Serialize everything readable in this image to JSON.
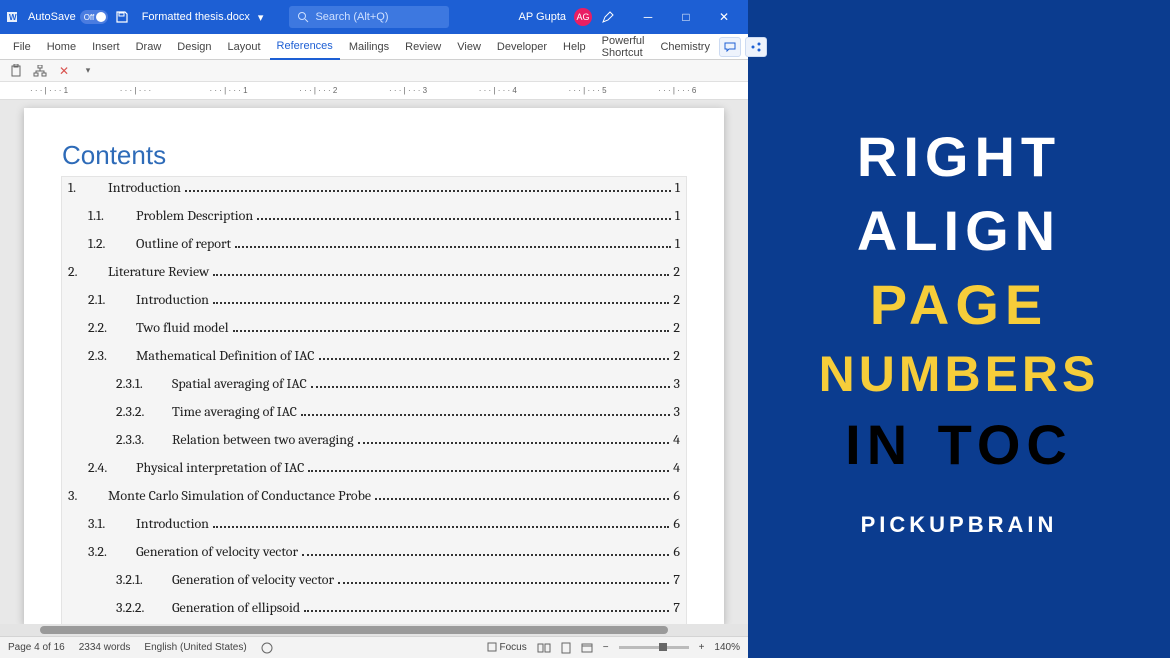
{
  "titlebar": {
    "autosave_label": "AutoSave",
    "toggle_text": "Off",
    "doc_name": "Formatted thesis.docx",
    "search_placeholder": "Search (Alt+Q)",
    "user_name": "AP Gupta",
    "user_initials": "AG"
  },
  "ribbon_tabs": [
    "File",
    "Home",
    "Insert",
    "Draw",
    "Design",
    "Layout",
    "References",
    "Mailings",
    "Review",
    "View",
    "Developer",
    "Help",
    "Powerful Shortcut",
    "Chemistry"
  ],
  "active_tab": "References",
  "ruler_marks": [
    "1",
    "",
    "1",
    "2",
    "3",
    "4",
    "5",
    "6"
  ],
  "toc": {
    "title": "Contents",
    "entries": [
      {
        "level": 1,
        "num": "1.",
        "text": "Introduction",
        "page": "1"
      },
      {
        "level": 2,
        "num": "1.1.",
        "text": "Problem Description",
        "page": "1"
      },
      {
        "level": 2,
        "num": "1.2.",
        "text": "Outline of report",
        "page": "1"
      },
      {
        "level": 1,
        "num": "2.",
        "text": "Literature Review",
        "page": "2"
      },
      {
        "level": 2,
        "num": "2.1.",
        "text": "Introduction",
        "page": "2"
      },
      {
        "level": 2,
        "num": "2.2.",
        "text": "Two fluid model",
        "page": "2"
      },
      {
        "level": 2,
        "num": "2.3.",
        "text": "Mathematical Definition of IAC",
        "page": "2"
      },
      {
        "level": 3,
        "num": "2.3.1.",
        "text": "Spatial averaging of IAC",
        "page": "3"
      },
      {
        "level": 3,
        "num": "2.3.2.",
        "text": "Time averaging of IAC",
        "page": "3"
      },
      {
        "level": 3,
        "num": "2.3.3.",
        "text": "Relation between two averaging",
        "page": "4"
      },
      {
        "level": 2,
        "num": "2.4.",
        "text": "Physical interpretation of IAC",
        "page": "4"
      },
      {
        "level": 1,
        "num": "3.",
        "text": "Monte Carlo Simulation of Conductance Probe",
        "page": "6"
      },
      {
        "level": 2,
        "num": "3.1.",
        "text": "Introduction",
        "page": "6"
      },
      {
        "level": 2,
        "num": "3.2.",
        "text": "Generation of velocity vector",
        "page": "6"
      },
      {
        "level": 3,
        "num": "3.2.1.",
        "text": "Generation of velocity vector",
        "page": "7"
      },
      {
        "level": 3,
        "num": "3.2.2.",
        "text": "Generation of ellipsoid",
        "page": "7"
      }
    ]
  },
  "statusbar": {
    "page_info": "Page 4 of 16",
    "word_count": "2334 words",
    "language": "English (United States)",
    "focus_label": "Focus",
    "zoom_level": "140%"
  },
  "promo": {
    "line1": "RIGHT",
    "line2": "ALIGN",
    "line3": "PAGE",
    "line4": "NUMBERS",
    "line5a": "IN",
    "line5b": "TOC",
    "brand": "PICKUPBRAIN"
  }
}
